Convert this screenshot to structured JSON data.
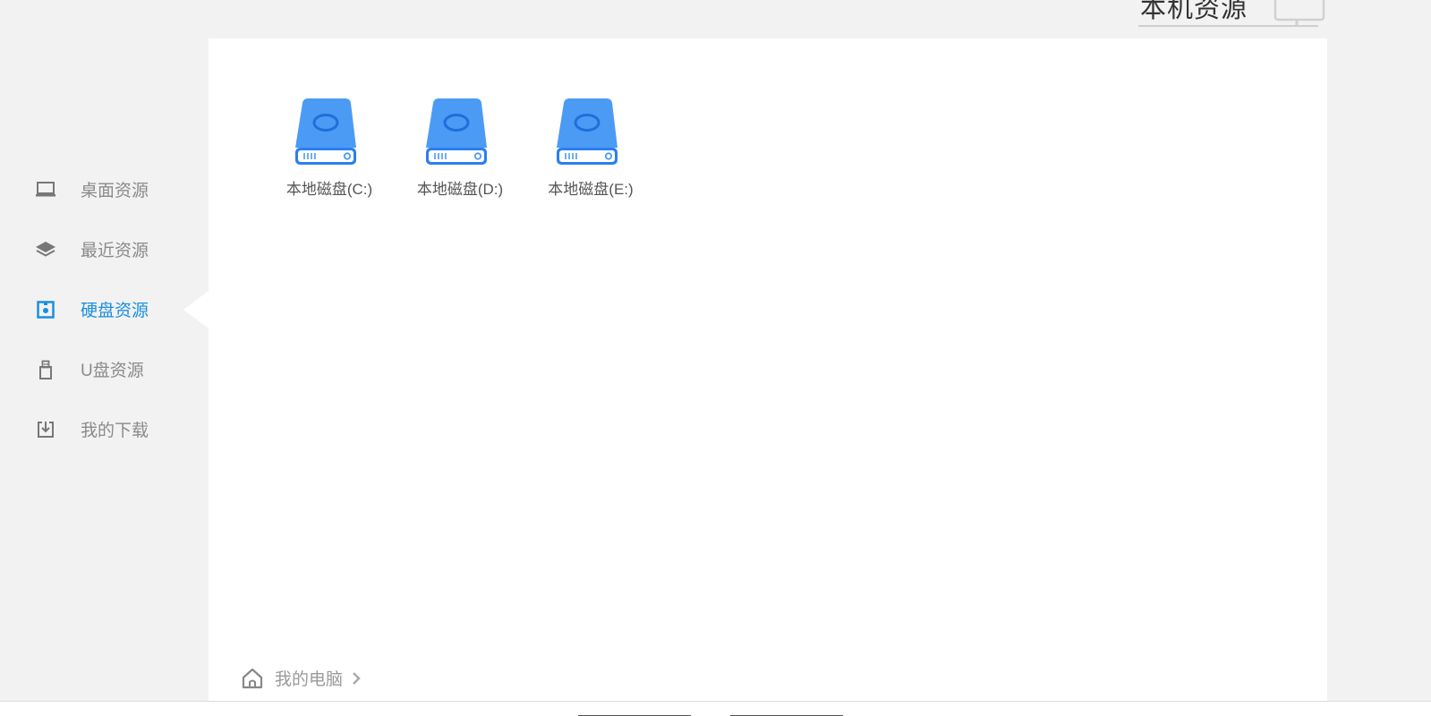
{
  "header": {
    "title": "本机资源",
    "icon": "monitor-icon"
  },
  "sidebar": {
    "items": [
      {
        "label": "桌面资源",
        "icon": "laptop-icon",
        "active": false
      },
      {
        "label": "最近资源",
        "icon": "layers-icon",
        "active": false
      },
      {
        "label": "硬盘资源",
        "icon": "hard-disk-icon",
        "active": true
      },
      {
        "label": "U盘资源",
        "icon": "usb-drive-icon",
        "active": false
      },
      {
        "label": "我的下载",
        "icon": "download-icon",
        "active": false
      }
    ]
  },
  "main": {
    "drives": [
      {
        "label": "本地磁盘(C:)",
        "icon": "hard-drive-icon"
      },
      {
        "label": "本地磁盘(D:)",
        "icon": "hard-drive-icon"
      },
      {
        "label": "本地磁盘(E:)",
        "icon": "hard-drive-icon"
      }
    ],
    "breadcrumb": {
      "home_icon": "home-icon",
      "items": [
        "我的电脑"
      ],
      "separator_icon": "chevron-right-icon"
    }
  },
  "colors": {
    "accent": "#1a8fe0",
    "drive_blue": "#4b9bf5",
    "drive_dark": "#2a7ff0",
    "background": "#f2f2f2",
    "panel": "#ffffff",
    "muted_text": "#8a8a8a"
  }
}
